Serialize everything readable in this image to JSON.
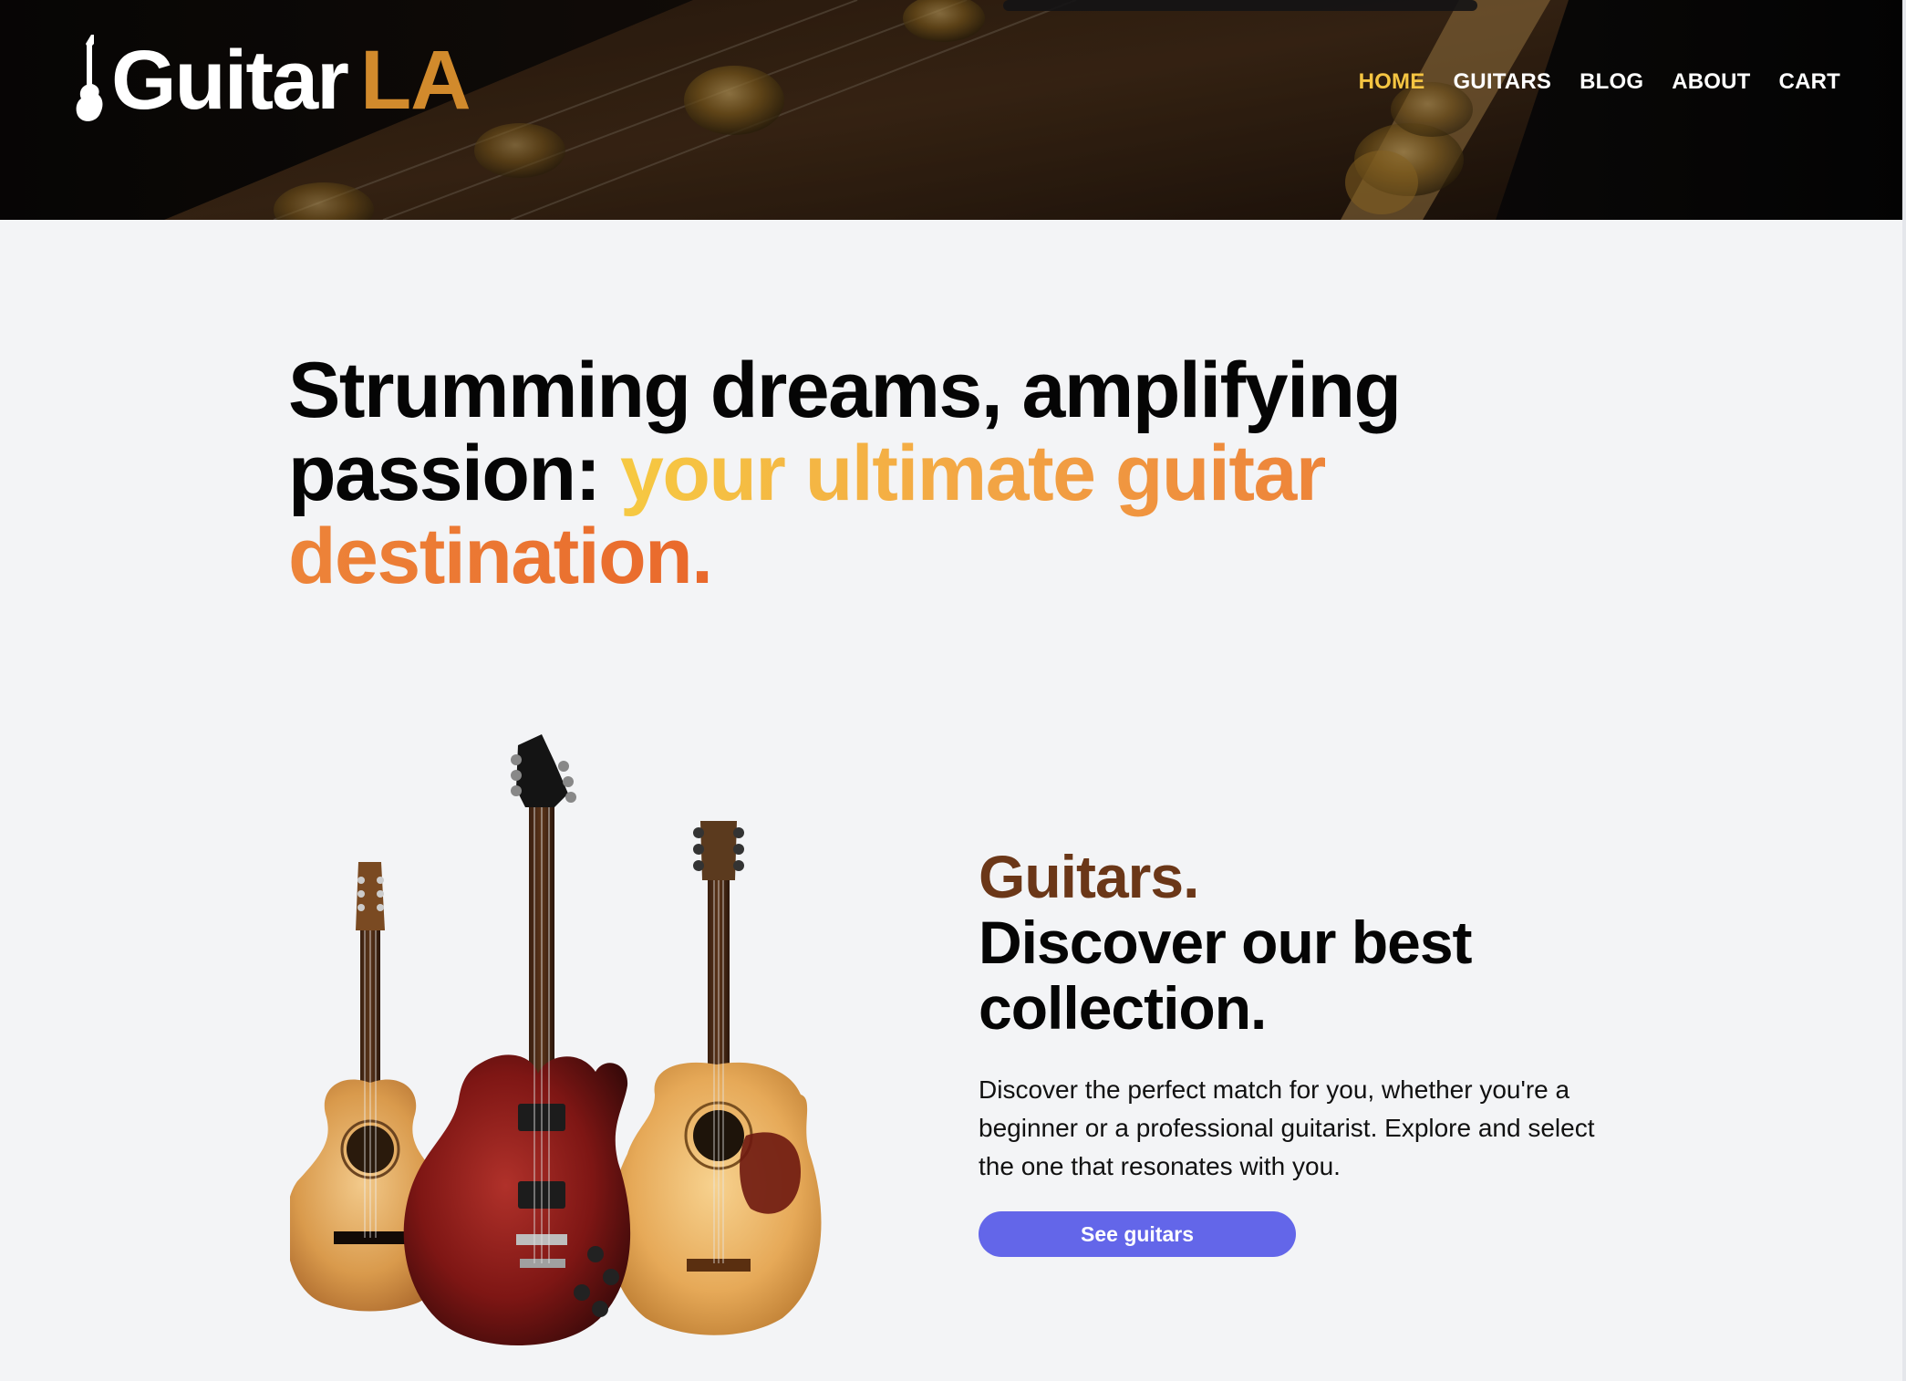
{
  "header": {
    "logo": {
      "icon": "guitar-silhouette-icon",
      "text": "Guitar",
      "accent": "LA"
    },
    "nav": [
      {
        "label": "HOME",
        "active": true
      },
      {
        "label": "GUITARS",
        "active": false
      },
      {
        "label": "BLOG",
        "active": false
      },
      {
        "label": "ABOUT",
        "active": false
      },
      {
        "label": "CART",
        "active": false
      }
    ]
  },
  "hero": {
    "headline_plain": "Strumming dreams, amplifying passion: ",
    "headline_highlight": "your ultimate guitar destination."
  },
  "collection": {
    "kicker": "Guitars.",
    "title": "Discover our best collection.",
    "description": "Discover the perfect match for you, whether you're a beginner or a professional guitarist. Explore and select the one that resonates with you.",
    "button_label": "See guitars"
  },
  "colors": {
    "page_bg": "#f3f4f6",
    "logo_accent": "#d18a2c",
    "nav_active": "#f5c542",
    "kicker": "#6b3718",
    "button": "#6366e9",
    "gradient": [
      "#f6c942",
      "#f3a845",
      "#ee8a3c",
      "#e9682b"
    ]
  }
}
